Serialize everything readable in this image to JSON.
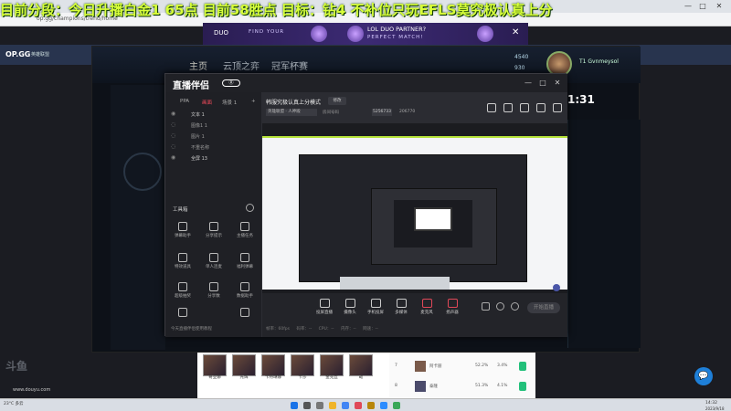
{
  "overlay": {
    "text": "目前分段：今日升播白金1 65点  目前58胜点 目标：钻4 不补位只玩EFLS莫究极认真上分"
  },
  "browser": {
    "url": "op.gg/champions/trend/home"
  },
  "ad": {
    "brand": "DUO",
    "left_text": "FIND YOUR",
    "line1": "LOL DUO PARTNER?",
    "line2": "PERFECT MATCH!",
    "close": "✕"
  },
  "opgg": {
    "logo": "OP.GG",
    "game": "英雄联盟"
  },
  "client": {
    "nav": [
      "主页",
      "云顶之弈",
      "冠军杯赛"
    ],
    "stat1": "4540",
    "stat2": "930",
    "user": "T1 Gvnmeysol",
    "timer": "1:31"
  },
  "app": {
    "logo": "直播伴侣",
    "badge": "Ⓡ",
    "controls": [
      "—",
      "□",
      "✕"
    ],
    "side_tabs": [
      "PPA",
      "画面",
      "场景 1",
      "+"
    ],
    "scenes": [
      {
        "label": "文本 1",
        "active": true
      },
      {
        "label": "图像1 1",
        "active": false
      },
      {
        "label": "图片 1",
        "active": false
      },
      {
        "label": "不重名称",
        "active": false
      },
      {
        "label": "全屏 13",
        "active": true
      }
    ],
    "toolbox_title": "工具箱",
    "tools": [
      "弹幕助手",
      "分享提示",
      "主播任务",
      "特效道具",
      "单人连麦",
      "福利弹幕",
      "超级抽奖",
      "分享数",
      "数据助手",
      "更多",
      "PK",
      "连麦"
    ],
    "notice": "今天直播伴侣使用教程",
    "room_title": "韩服究极认真上分模式",
    "room_edit": "修改",
    "room_cat": "英雄联盟 · 人神殿",
    "room_info": "房间号码",
    "room_id": "5256733",
    "room_fans": "206770",
    "bottom_tools": [
      "投屏直播",
      "摄像头",
      "手机投屏",
      "多媒体",
      "麦克风",
      "扬声器"
    ],
    "start_button": "开始直播",
    "bottom_stats": "帧率：60fps  码率：--  CPU：--  内存：--  网速：--"
  },
  "page": {
    "champs": [
      "奇亚娜",
      "光辉",
      "卡特琳娜",
      "卡莎",
      "金克丝",
      "劫",
      "伊泽瑞尔"
    ],
    "rows": [
      {
        "rank": "7",
        "name": "阿卡丽",
        "pct1": "52.2%",
        "pct2": "3.4%"
      },
      {
        "rank": "8",
        "name": "泰隆",
        "pct1": "51.3%",
        "pct2": "4.1%"
      }
    ]
  },
  "left_logo": "斗鱼",
  "left_logo2": "www.douyu.com",
  "chat_button": "💬",
  "taskbar": {
    "weather": "23°C 多云",
    "time": "14:32",
    "date": "2023/9/18"
  }
}
